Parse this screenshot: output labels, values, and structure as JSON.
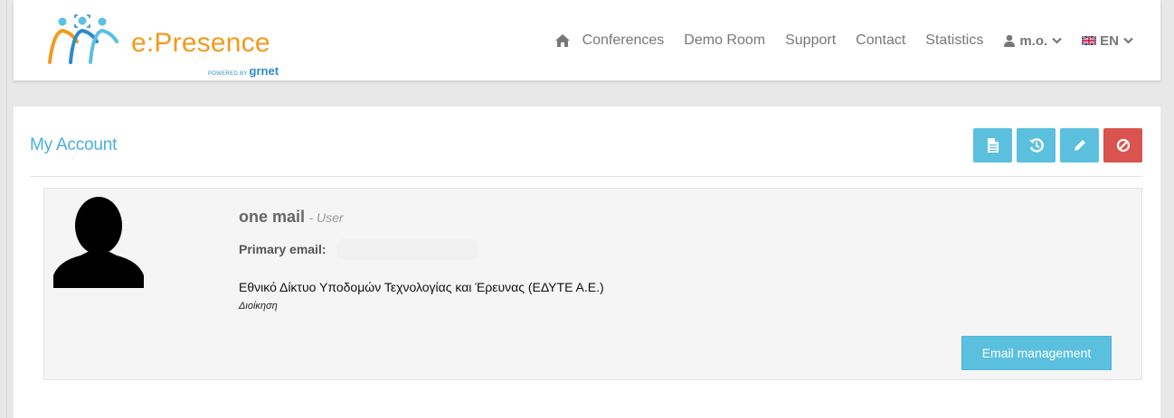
{
  "header": {
    "logo": {
      "brand": "e:Presence",
      "powered_by": "POWERED BY",
      "provider": "grnet"
    },
    "nav": {
      "home_icon": "home-icon",
      "links": [
        "Conferences",
        "Demo Room",
        "Support",
        "Contact",
        "Statistics"
      ],
      "user": {
        "icon": "user-icon",
        "label": "m.o."
      },
      "language": {
        "flag": "uk-flag-icon",
        "label": "EN"
      }
    }
  },
  "page": {
    "title": "My Account",
    "toolbar": [
      {
        "icon": "document-icon",
        "color": "#5bc0de"
      },
      {
        "icon": "history-icon",
        "color": "#5bc0de"
      },
      {
        "icon": "pencil-icon",
        "color": "#5bc0de"
      },
      {
        "icon": "ban-icon",
        "color": "#d9534f"
      }
    ]
  },
  "profile": {
    "name": "one mail",
    "role": "- User",
    "primary_email_label": "Primary email:",
    "primary_email_value": "",
    "organization": "Εθνικό Δίκτυο Υποδομών Τεχνολογίας και Έρευνας (ΕΔΥΤΕ Α.Ε.)",
    "department": "Διοίκηση",
    "email_management_label": "Email management"
  },
  "colors": {
    "accent": "#4aaee0",
    "info_button": "#5bc0de",
    "danger_button": "#d9534f",
    "logo_orange": "#f39a1d",
    "logo_blue": "#2a8bc8"
  }
}
